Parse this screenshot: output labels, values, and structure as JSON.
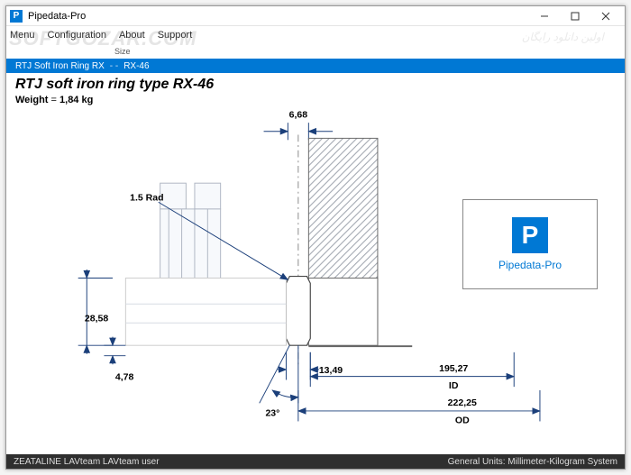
{
  "title": "Pipedata-Pro",
  "menu": {
    "items": [
      "Menu",
      "Configuration",
      "About",
      "Support"
    ]
  },
  "size_label": "Size",
  "breadcrumb": {
    "group": "RTJ Soft Iron Ring RX",
    "item": "RX-46"
  },
  "page": {
    "title": "RTJ soft iron ring type RX-46",
    "weight_label": "Weight",
    "weight_value": "1,84 kg"
  },
  "logo": {
    "letter": "P",
    "label": "Pipedata-Pro"
  },
  "dimensions": {
    "top_width": "6,68",
    "radius_note": "1.5 Rad",
    "left_height": "28,58",
    "left_small": "4,78",
    "angle": "23°",
    "bottom_small": "13,49",
    "id_value": "195,27",
    "id_label": "ID",
    "od_value": "222,25",
    "od_label": "OD"
  },
  "status": {
    "left": "ZEATALINE   LAVteam   LAVteam user",
    "right": "General Units: Millimeter-Kilogram System"
  },
  "watermark": "SOFTGOZAR.COM",
  "watermark2": "اولین دانلود رایگان"
}
